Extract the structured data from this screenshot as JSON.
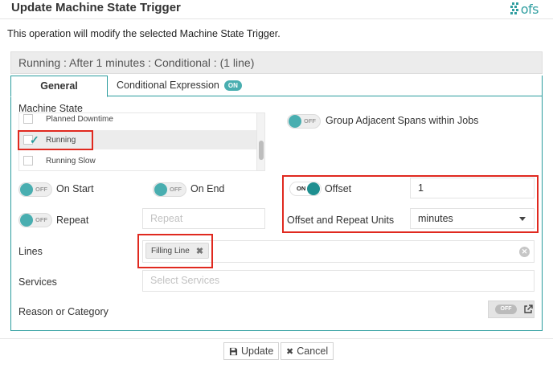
{
  "dialog": {
    "title": "Update Machine State Trigger",
    "logo_text": "ofs",
    "intro": "This operation will modify the selected Machine State Trigger."
  },
  "summary": "Running : After 1 minutes : Conditional : (1 line)",
  "tabs": {
    "general": "General",
    "conditional": "Conditional Expression",
    "conditional_badge": "ON"
  },
  "machine_state": {
    "label": "Machine State",
    "items": [
      {
        "label": "Planned Downtime",
        "checked": false
      },
      {
        "label": "Running",
        "checked": true
      },
      {
        "label": "Running Slow",
        "checked": false
      }
    ]
  },
  "toggles": {
    "off_text": "OFF",
    "on_text": "ON",
    "group_adjacent": "Group Adjacent Spans within Jobs",
    "on_start": "On Start",
    "on_end": "On End",
    "repeat": "Repeat",
    "offset": "Offset"
  },
  "fields": {
    "repeat_placeholder": "Repeat",
    "offset_value": "1",
    "units_label": "Offset and Repeat Units",
    "units_value": "minutes",
    "lines_label": "Lines",
    "lines_tag": "Filling Line",
    "services_label": "Services",
    "services_placeholder": "Select Services",
    "reason_label": "Reason or Category",
    "reason_toggle": "OFF"
  },
  "footer": {
    "update": "Update",
    "cancel": "Cancel"
  },
  "colors": {
    "accent": "#2a9c9d",
    "highlight": "#e0291f"
  }
}
